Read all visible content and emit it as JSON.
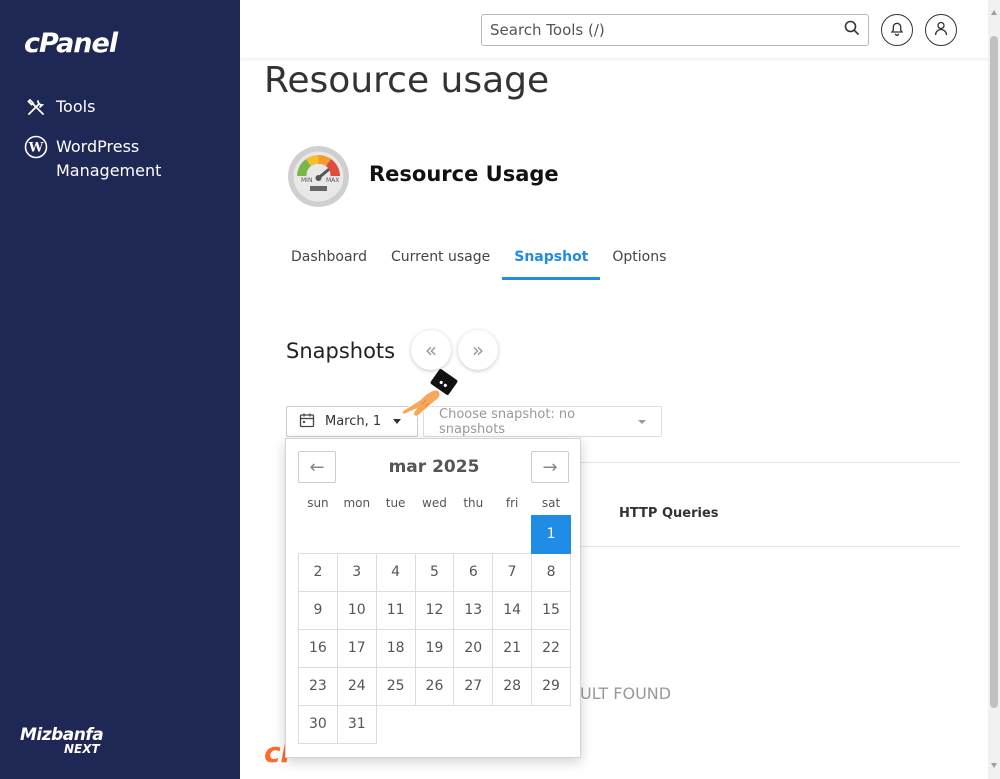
{
  "sidebar": {
    "logo": "cPanel",
    "items": [
      {
        "label": "Tools",
        "icon": "tools-icon"
      },
      {
        "label": "WordPress",
        "label2": "Management",
        "icon": "wordpress-icon"
      }
    ],
    "footer_logo_line1": "Mizbanfa",
    "footer_logo_line2": "NEXT"
  },
  "header": {
    "search_placeholder": "Search Tools (/)",
    "icons": [
      "search-icon",
      "bell-icon",
      "user-icon"
    ]
  },
  "main": {
    "title": "Resource usage",
    "app_title": "Resource Usage",
    "gauge_labels": {
      "min": "MIN",
      "max": "MAX"
    },
    "tabs": [
      {
        "label": "Dashboard",
        "active": false
      },
      {
        "label": "Current usage",
        "active": false
      },
      {
        "label": "Snapshot",
        "active": true
      },
      {
        "label": "Options",
        "active": false
      }
    ],
    "snapshots_title": "Snapshots",
    "date_value": "March, 1",
    "snapshot_select": "Choose snapshot: no snapshots",
    "table_header": "HTTP Queries",
    "no_result": "ULT FOUND"
  },
  "calendar": {
    "month": "mar 2025",
    "prev": "←",
    "next": "→",
    "weekdays": [
      "sun",
      "mon",
      "tue",
      "wed",
      "thu",
      "fri",
      "sat"
    ],
    "weeks": [
      [
        "",
        "",
        "",
        "",
        "",
        "",
        "1"
      ],
      [
        "2",
        "3",
        "4",
        "5",
        "6",
        "7",
        "8"
      ],
      [
        "9",
        "10",
        "11",
        "12",
        "13",
        "14",
        "15"
      ],
      [
        "16",
        "17",
        "18",
        "19",
        "20",
        "21",
        "22"
      ],
      [
        "23",
        "24",
        "25",
        "26",
        "27",
        "28",
        "29"
      ],
      [
        "30",
        "31",
        "",
        "",
        "",
        "",
        ""
      ]
    ],
    "selected": "1"
  },
  "colors": {
    "sidebar_bg": "#1f2855",
    "accent": "#1f8ce6"
  }
}
